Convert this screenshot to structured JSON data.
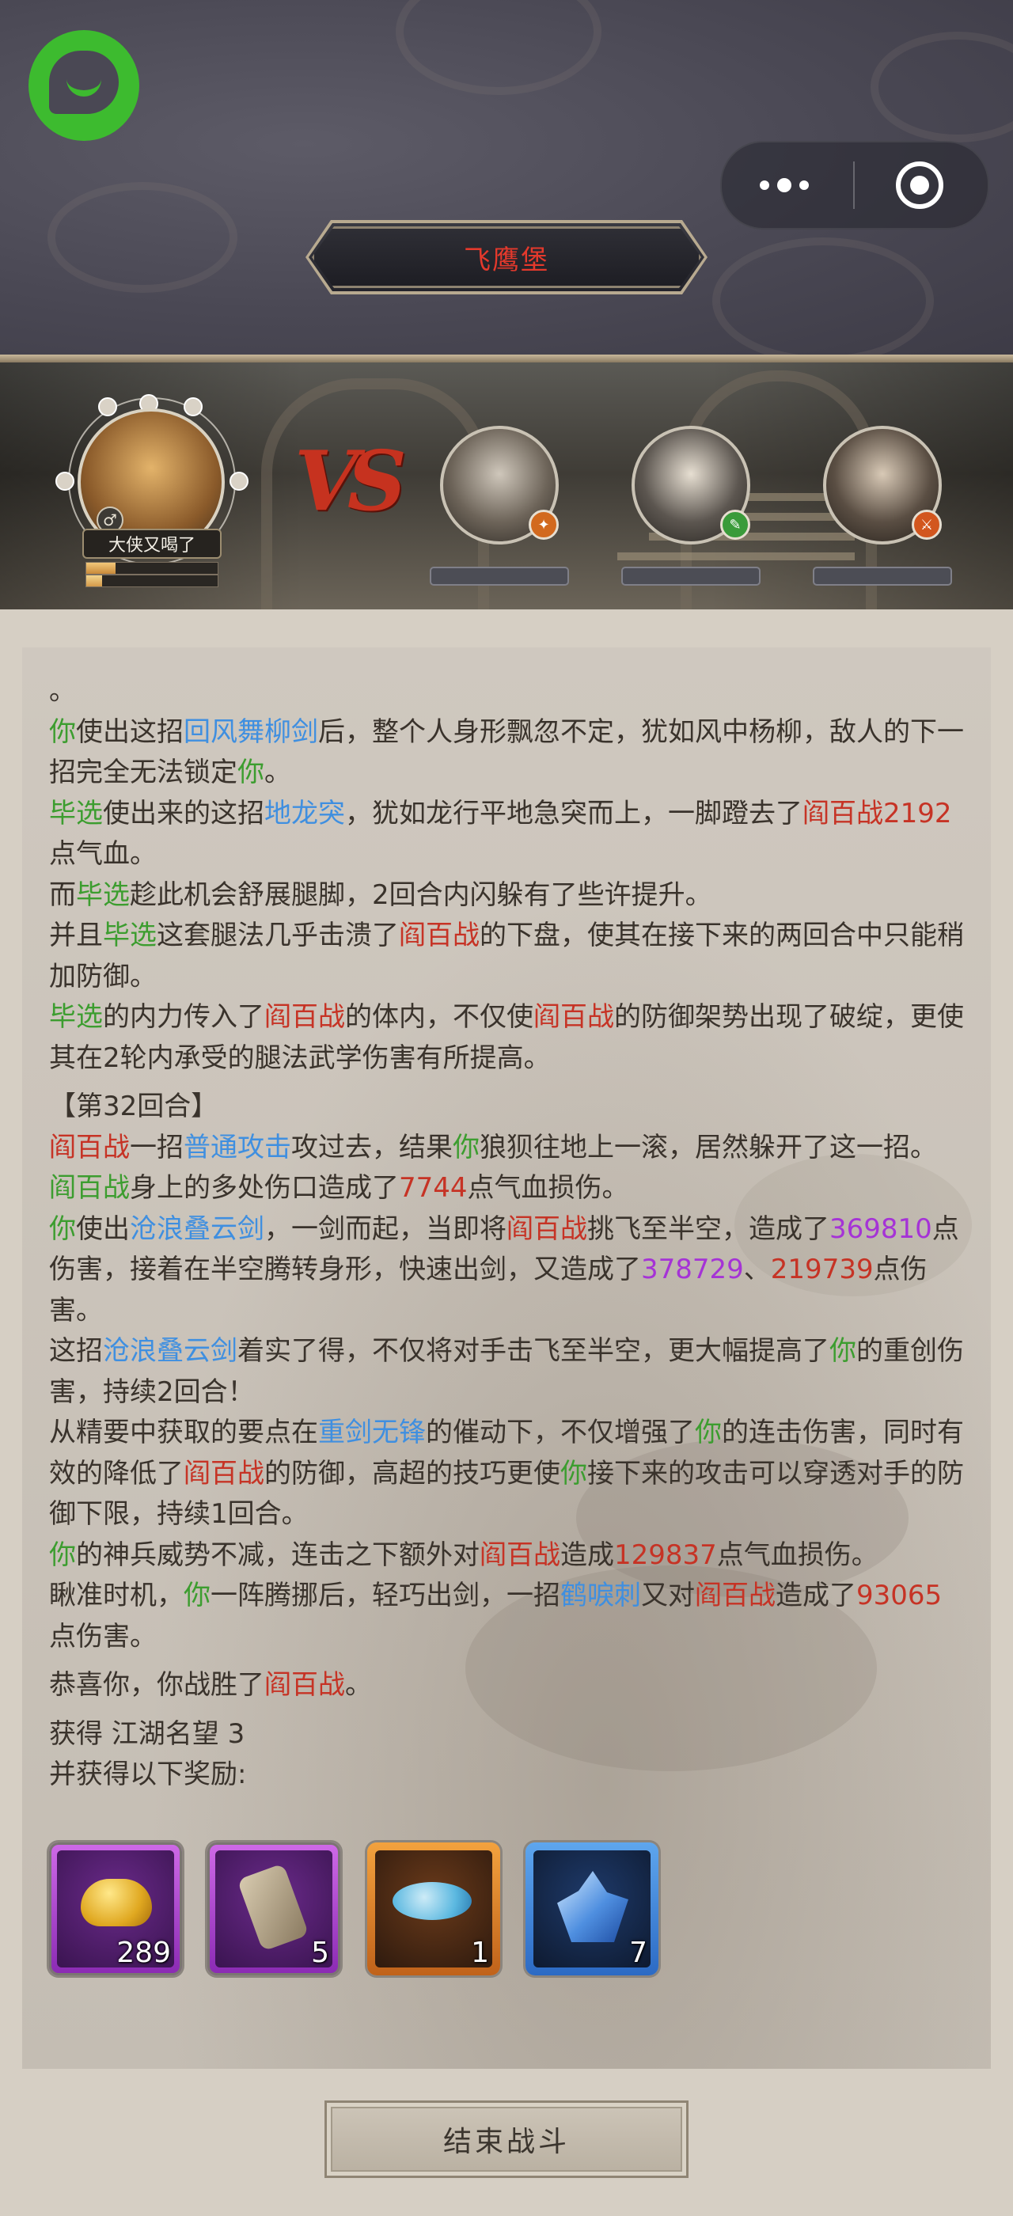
{
  "header": {
    "title": "飞鹰堡"
  },
  "battle": {
    "player_name": "大侠又喝了",
    "gender_symbol": "♂",
    "vs_label": "VS",
    "player_hp": 0.22,
    "player_mp": 0.12
  },
  "log": {
    "lines": [
      [
        {
          "t": "。",
          "c": ""
        }
      ],
      [
        {
          "t": "你",
          "c": "g"
        },
        {
          "t": "使出这招",
          "c": ""
        },
        {
          "t": "回风舞柳剑",
          "c": "b"
        },
        {
          "t": "后，整个人身形飘忽不定，犹如风中杨柳，敌人的下一招完全无法锁定",
          "c": ""
        },
        {
          "t": "你",
          "c": "g"
        },
        {
          "t": "。",
          "c": ""
        }
      ],
      [
        {
          "t": "毕选",
          "c": "g"
        },
        {
          "t": "使出来的这招",
          "c": ""
        },
        {
          "t": "地龙突",
          "c": "b"
        },
        {
          "t": "，犹如龙行平地急突而上，一脚蹬去了",
          "c": ""
        },
        {
          "t": "阎百战",
          "c": "r"
        },
        {
          "t": "2192",
          "c": "r"
        },
        {
          "t": "点气血。",
          "c": ""
        }
      ],
      [
        {
          "t": "而",
          "c": ""
        },
        {
          "t": "毕选",
          "c": "g"
        },
        {
          "t": "趁此机会舒展腿脚，2回合内闪躲有了些许提升。",
          "c": ""
        }
      ],
      [
        {
          "t": "并且",
          "c": ""
        },
        {
          "t": "毕选",
          "c": "g"
        },
        {
          "t": "这套腿法几乎击溃了",
          "c": ""
        },
        {
          "t": "阎百战",
          "c": "r"
        },
        {
          "t": "的下盘，使其在接下来的两回合中只能稍加防御。",
          "c": ""
        }
      ],
      [
        {
          "t": "毕选",
          "c": "g"
        },
        {
          "t": "的内力传入了",
          "c": ""
        },
        {
          "t": "阎百战",
          "c": "r"
        },
        {
          "t": "的体内，不仅使",
          "c": ""
        },
        {
          "t": "阎百战",
          "c": "r"
        },
        {
          "t": "的防御架势出现了破绽，更使其在2轮内承受的腿法武学伤害有所提高。",
          "c": ""
        }
      ],
      [
        {
          "t": "",
          "c": "gap"
        }
      ],
      [
        {
          "t": "【第32回合】",
          "c": ""
        }
      ],
      [
        {
          "t": "阎百战",
          "c": "r"
        },
        {
          "t": "一招",
          "c": ""
        },
        {
          "t": "普通攻击",
          "c": "b"
        },
        {
          "t": "攻过去，结果",
          "c": ""
        },
        {
          "t": "你",
          "c": "g"
        },
        {
          "t": "狼狈往地上一滚，居然躲开了这一招。",
          "c": ""
        }
      ],
      [
        {
          "t": "阎百战",
          "c": "g"
        },
        {
          "t": "身上的多处伤口造成了",
          "c": ""
        },
        {
          "t": "7744",
          "c": "r"
        },
        {
          "t": "点气血损伤。",
          "c": ""
        }
      ],
      [
        {
          "t": "你",
          "c": "g"
        },
        {
          "t": "使出",
          "c": ""
        },
        {
          "t": "沧浪叠云剑",
          "c": "b"
        },
        {
          "t": "，一剑而起，当即将",
          "c": ""
        },
        {
          "t": "阎百战",
          "c": "r"
        },
        {
          "t": "挑飞至半空，造成了",
          "c": ""
        },
        {
          "t": "369810",
          "c": "p"
        },
        {
          "t": "点伤害，接着在半空腾转身形，快速出剑，又造成了",
          "c": ""
        },
        {
          "t": "378729",
          "c": "p"
        },
        {
          "t": "、",
          "c": ""
        },
        {
          "t": "219739",
          "c": "r"
        },
        {
          "t": "点伤害。",
          "c": ""
        }
      ],
      [
        {
          "t": "这招",
          "c": ""
        },
        {
          "t": "沧浪叠云剑",
          "c": "b"
        },
        {
          "t": "着实了得，不仅将对手击飞至半空，更大幅提高了",
          "c": ""
        },
        {
          "t": "你",
          "c": "g"
        },
        {
          "t": "的重创伤害，持续2回合！",
          "c": ""
        }
      ],
      [
        {
          "t": "从精要中获取的要点在",
          "c": ""
        },
        {
          "t": "重剑无锋",
          "c": "b"
        },
        {
          "t": "的催动下，不仅增强了",
          "c": ""
        },
        {
          "t": "你",
          "c": "g"
        },
        {
          "t": "的连击伤害，同时有效的降低了",
          "c": ""
        },
        {
          "t": "阎百战",
          "c": "r"
        },
        {
          "t": "的防御，高超的技巧更使",
          "c": ""
        },
        {
          "t": "你",
          "c": "g"
        },
        {
          "t": "接下来的攻击可以穿透对手的防御下限，持续1回合。",
          "c": ""
        }
      ],
      [
        {
          "t": "你",
          "c": "g"
        },
        {
          "t": "的神兵威势不减，连击之下额外对",
          "c": ""
        },
        {
          "t": "阎百战",
          "c": "r"
        },
        {
          "t": "造成",
          "c": ""
        },
        {
          "t": "129837",
          "c": "r"
        },
        {
          "t": "点气血损伤。",
          "c": ""
        }
      ],
      [
        {
          "t": "瞅准时机，",
          "c": ""
        },
        {
          "t": "你",
          "c": "g"
        },
        {
          "t": "一阵腾挪后，轻巧出剑，一招",
          "c": ""
        },
        {
          "t": "鹤唳刺",
          "c": "b"
        },
        {
          "t": "又对",
          "c": ""
        },
        {
          "t": "阎百战",
          "c": "r"
        },
        {
          "t": "造成了",
          "c": ""
        },
        {
          "t": "93065",
          "c": "r"
        },
        {
          "t": "点伤害。",
          "c": ""
        }
      ],
      [
        {
          "t": "",
          "c": "gap"
        }
      ],
      [
        {
          "t": "恭喜你，你战胜了",
          "c": ""
        },
        {
          "t": "阎百战",
          "c": "r"
        },
        {
          "t": "。",
          "c": ""
        }
      ]
    ],
    "reward_label": "获得 江湖名望 3",
    "reward_sub": "并获得以下奖励:"
  },
  "rewards": [
    {
      "name": "gold-ingot",
      "qty": "289",
      "rarity": "purple"
    },
    {
      "name": "scroll-item",
      "qty": "5",
      "rarity": "purple"
    },
    {
      "name": "cloud-spirit-item",
      "qty": "1",
      "rarity": "orange"
    },
    {
      "name": "blue-crystal-item",
      "qty": "7",
      "rarity": "blue"
    }
  ],
  "end_button": "结束战斗",
  "colors": {
    "green": "#3c9d2f",
    "blue": "#3f8fe0",
    "red": "#c63325",
    "purple": "#a533d6"
  }
}
